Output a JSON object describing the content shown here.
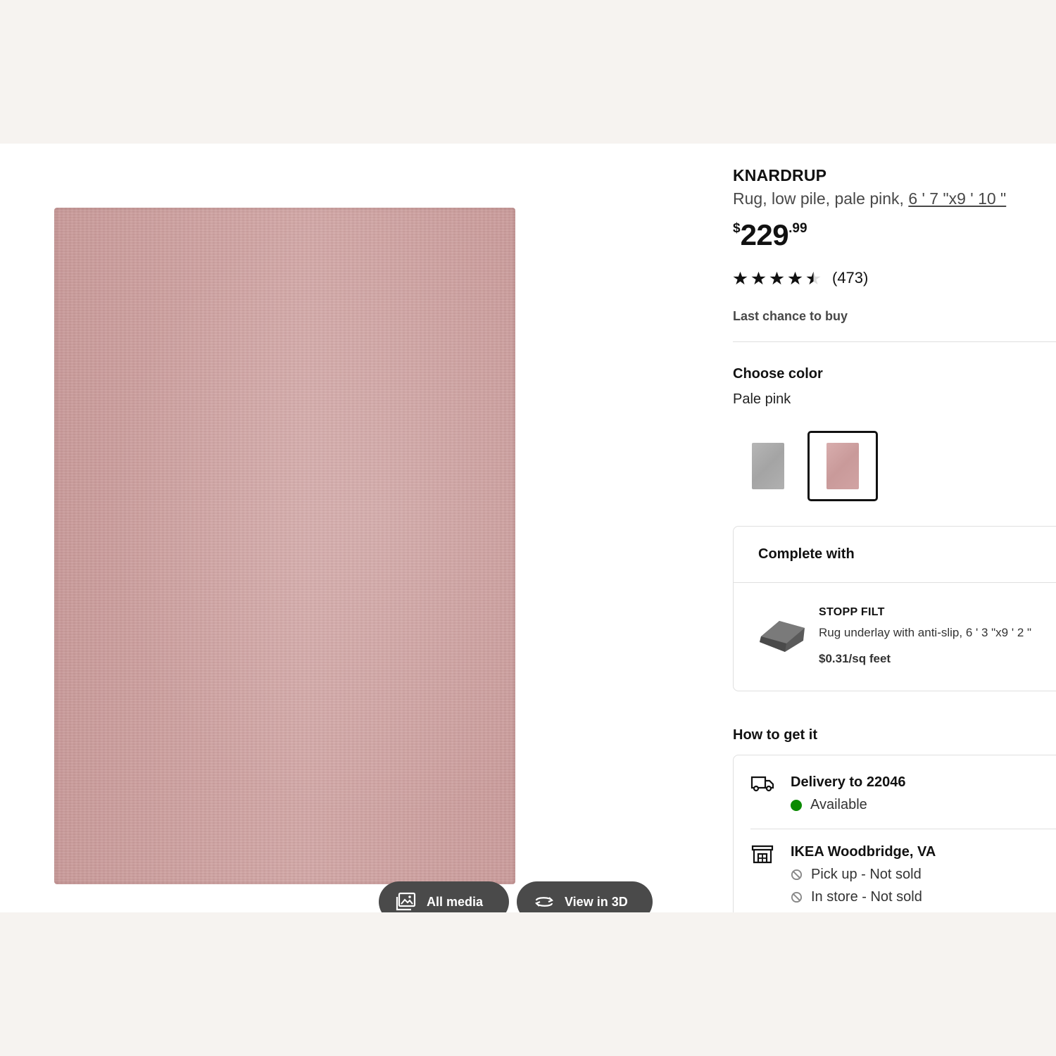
{
  "product": {
    "name": "KNARDRUP",
    "description": "Rug, low pile, pale pink,",
    "size_link": "6 ' 7 \"x9 ' 10 \"",
    "price": {
      "currency": "$",
      "integer": "229",
      "decimal": ".99"
    },
    "rating": {
      "value": 4.5,
      "max": 5,
      "count": "(473)"
    },
    "notice": "Last chance to buy"
  },
  "media_buttons": {
    "all_media": "All media",
    "view_3d": "View in 3D"
  },
  "color": {
    "heading": "Choose color",
    "selected": "Pale pink",
    "options": [
      {
        "name": "grey",
        "hex": "#acacac"
      },
      {
        "name": "pale pink",
        "hex": "#cfa1a0",
        "selected": true
      }
    ]
  },
  "complete_with": {
    "heading": "Complete with",
    "item": {
      "name": "STOPP FILT",
      "description": "Rug underlay with anti-slip, 6 ' 3 \"x9 ' 2 \"",
      "price": "$0.31/sq feet"
    }
  },
  "how_to_get": {
    "heading": "How to get it",
    "delivery": {
      "title": "Delivery to 22046",
      "status": "Available",
      "status_color": "#0a8a00"
    },
    "store": {
      "title": "IKEA Woodbridge, VA",
      "pickup": "Pick up - Not sold",
      "in_store": "In store - Not sold"
    }
  },
  "colors": {
    "page_background": "#f6f3f0",
    "panel_background": "#ffffff",
    "button_dark": "#4a4a4a",
    "rug": "#cfa1a0"
  }
}
